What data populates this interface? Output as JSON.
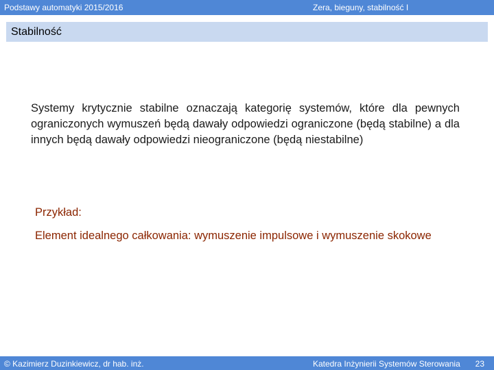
{
  "header": {
    "course": "Podstawy automatyki 2015/2016",
    "topic": "Zera, bieguny, stabilność I"
  },
  "section": {
    "title": "Stabilność"
  },
  "body": {
    "paragraph": "Systemy krytycznie stabilne oznaczają kategorię systemów, które dla pewnych ograniczonych wymuszeń będą dawały odpowiedzi ograniczone (będą stabilne) a dla innych będą dawały odpowiedzi nieograniczone (będą niestabilne)",
    "example_label": "Przykład:",
    "example_text": "Element idealnego całkowania: wymuszenie impulsowe i wymuszenie skokowe"
  },
  "footer": {
    "author": "© Kazimierz Duzinkiewicz, dr hab. inż.",
    "department": "Katedra Inżynierii Systemów Sterowania",
    "page_number": "23"
  }
}
